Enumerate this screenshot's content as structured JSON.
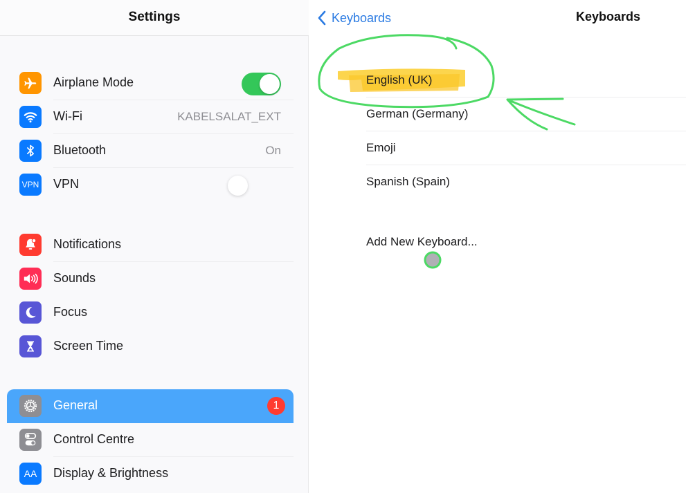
{
  "left_panel": {
    "title": "Settings",
    "groups": [
      {
        "items": [
          {
            "label": "Airplane Mode",
            "icon": "airplane-icon",
            "icon_color": "#ff9500",
            "control": "toggle",
            "toggle_on": true
          },
          {
            "label": "Wi-Fi",
            "icon": "wifi-icon",
            "icon_color": "#0a7aff",
            "value": "KABELSALAT_EXT"
          },
          {
            "label": "Bluetooth",
            "icon": "bluetooth-icon",
            "icon_color": "#0a7aff",
            "value": "On"
          },
          {
            "label": "VPN",
            "icon": "vpn-icon",
            "icon_text": "VPN",
            "icon_color": "#0a7aff",
            "control": "toggle",
            "toggle_on": false
          }
        ]
      },
      {
        "items": [
          {
            "label": "Notifications",
            "icon": "notifications-bell-icon",
            "icon_color": "#ff3b30"
          },
          {
            "label": "Sounds",
            "icon": "speaker-icon",
            "icon_color": "#ff2d55"
          },
          {
            "label": "Focus",
            "icon": "moon-icon",
            "icon_color": "#5856d6"
          },
          {
            "label": "Screen Time",
            "icon": "hourglass-icon",
            "icon_color": "#5856d6"
          }
        ]
      },
      {
        "items": [
          {
            "label": "General",
            "icon": "gear-icon",
            "icon_color": "#8e8e93",
            "selected": true,
            "badge": "1"
          },
          {
            "label": "Control Centre",
            "icon": "switches-icon",
            "icon_color": "#8e8e93"
          },
          {
            "label": "Display & Brightness",
            "icon": "text-size-icon",
            "icon_text": "AA",
            "icon_color": "#0a7aff"
          }
        ]
      }
    ]
  },
  "right_panel": {
    "back_label": "Keyboards",
    "title": "Keyboards",
    "keyboards": [
      "English (UK)",
      "German (Germany)",
      "Emoji",
      "Spanish (Spain)"
    ],
    "add_label": "Add New Keyboard..."
  },
  "colors": {
    "accent": "#2a7ae2",
    "selected_row": "#4aa6fb",
    "toggle_on": "#34c759",
    "badge": "#ff3b30",
    "annotation_green": "#4cd964",
    "highlighter_yellow": "#fcd03a"
  }
}
